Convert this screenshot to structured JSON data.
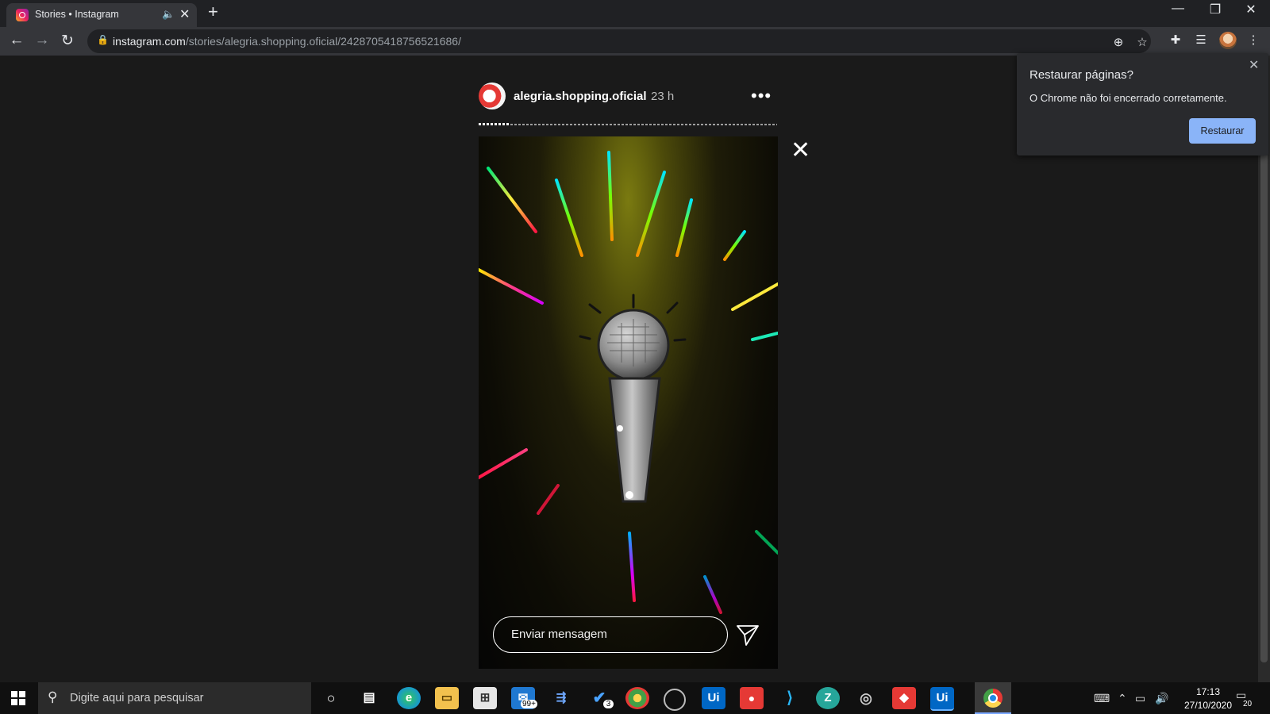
{
  "browser": {
    "tab": {
      "title": "Stories • Instagram",
      "audio_icon": "speaker-icon",
      "close": "✕"
    },
    "new_tab": "+",
    "window_controls": {
      "minimize": "—",
      "restore": "❐",
      "close": "✕"
    },
    "url": {
      "host": "instagram.com",
      "path": "/stories/alegria.shopping.oficial/2428705418756521686/"
    }
  },
  "story": {
    "username": "alegria.shopping.oficial",
    "time": "23 h",
    "menu": "•••",
    "close": "✕",
    "progress": 0.1,
    "message_placeholder": "Enviar mensagem",
    "media_description_icon": "microphone-icon"
  },
  "restore_popup": {
    "title": "Restaurar páginas?",
    "text": "O Chrome não foi encerrado corretamente.",
    "button": "Restaurar",
    "close": "✕"
  },
  "taskbar": {
    "search_placeholder": "Digite aqui para pesquisar",
    "mail_badge": "99+",
    "todo_badge": "3",
    "ui_app_1": "Ui",
    "ui_app_2": "Ui",
    "zoom_app": "Z",
    "clock_time": "17:13",
    "clock_date": "27/10/2020",
    "notifications": "20"
  },
  "colors": {
    "popup_button": "#8ab4f8",
    "tab_bg": "#35363a",
    "page_bg": "#1a1a1a"
  }
}
